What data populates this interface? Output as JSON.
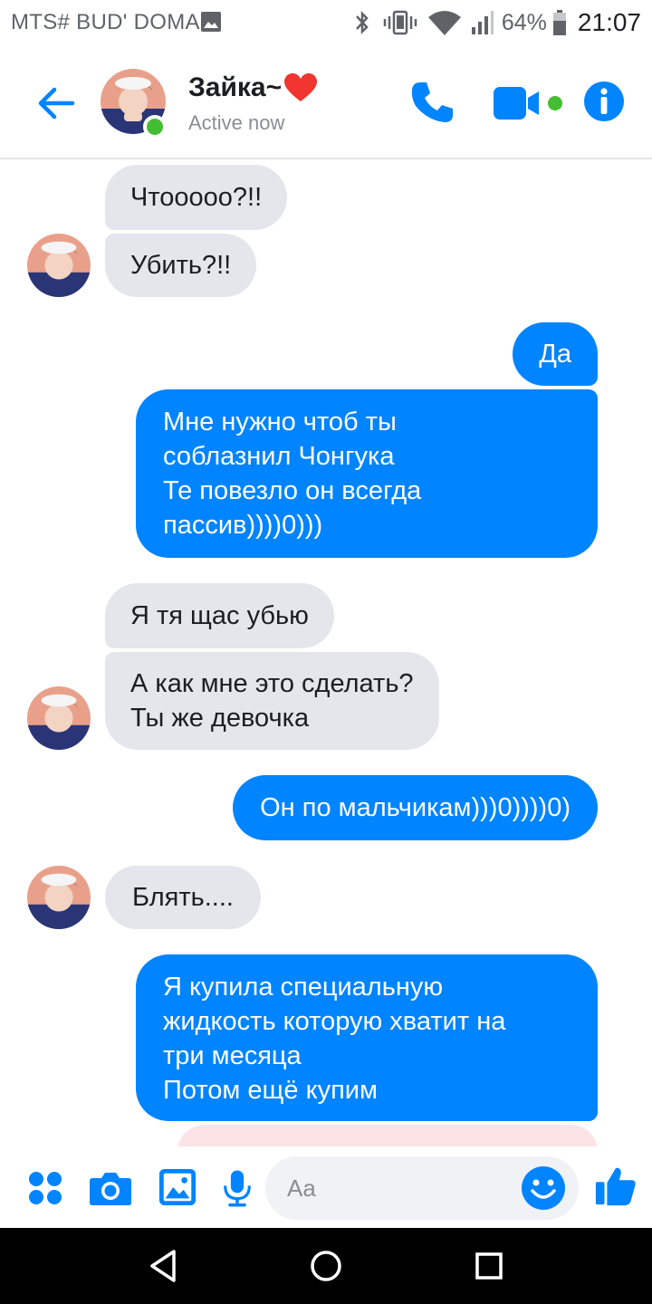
{
  "status_bar": {
    "carrier": "MTS# BUD' DOMA",
    "battery": "64%",
    "time": "21:07",
    "icons": [
      "image-notification-icon",
      "bluetooth-icon",
      "vibrate-icon",
      "wifi-icon",
      "signal-icon",
      "battery-icon"
    ]
  },
  "header": {
    "contact_name": "Зайка~",
    "status": "Active now",
    "icons": [
      "back-arrow-icon",
      "heart-icon",
      "phone-icon",
      "video-camera-icon",
      "info-icon"
    ],
    "accent_color": "#0084ff",
    "online_color": "#44bd32"
  },
  "messages": [
    {
      "from": "them",
      "text": "Чтооооо?!!"
    },
    {
      "from": "them",
      "text": "Убить?!!"
    },
    {
      "from": "me",
      "text": "Да"
    },
    {
      "from": "me",
      "text": "Мне нужно чтоб ты\nсоблазнил Чонгука\nТе повезло он всегда\nпассив))))0)))"
    },
    {
      "from": "them",
      "text": "Я тя щас убью"
    },
    {
      "from": "them",
      "text": "А как мне это сделать?\nТы же девочка"
    },
    {
      "from": "me",
      "text": "Он по мальчикам)))0))))0)"
    },
    {
      "from": "them",
      "text": "Блять...."
    },
    {
      "from": "me",
      "text": "Я купила специальную\nжидкость которую хватит на\nтри месяца\nПотом ещё купим"
    }
  ],
  "composer": {
    "placeholder": "Aa",
    "icons": [
      "apps-icon",
      "camera-icon",
      "gallery-icon",
      "microphone-icon",
      "emoji-icon",
      "thumbs-up-icon"
    ]
  },
  "nav_bar": {
    "icons": [
      "back-triangle-icon",
      "home-circle-icon",
      "recents-square-icon"
    ]
  },
  "colors": {
    "outgoing_bubble": "#0084ff",
    "incoming_bubble": "#e4e6eb"
  }
}
